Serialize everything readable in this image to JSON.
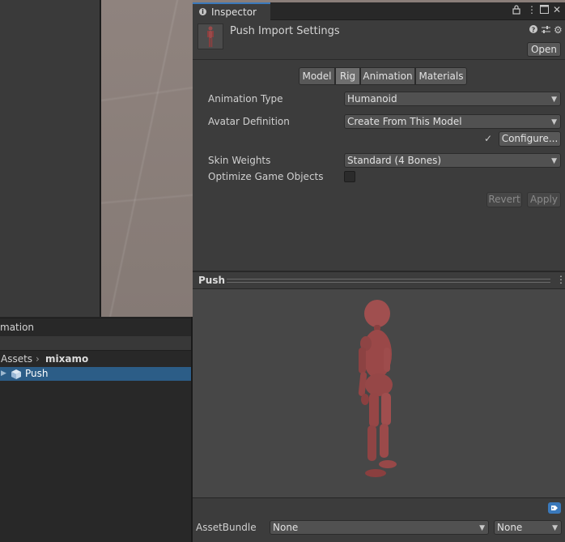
{
  "inspector": {
    "tab_label": "Inspector",
    "title": "Push Import Settings",
    "open_label": "Open",
    "header_icons": [
      "help-icon",
      "presets-icon",
      "settings-icon"
    ],
    "tab_icons": [
      "lock-icon",
      "more-icon",
      "maximize-icon",
      "close-icon"
    ],
    "tabs": [
      {
        "label": "Model",
        "active": false
      },
      {
        "label": "Rig",
        "active": true
      },
      {
        "label": "Animation",
        "active": false
      },
      {
        "label": "Materials",
        "active": false
      }
    ],
    "rig": {
      "animation_type_label": "Animation Type",
      "animation_type_value": "Humanoid",
      "avatar_definition_label": "Avatar Definition",
      "avatar_definition_value": "Create From This Model",
      "configure_label": "Configure...",
      "configure_check": "✓",
      "skin_weights_label": "Skin Weights",
      "skin_weights_value": "Standard (4 Bones)",
      "optimize_label": "Optimize Game Objects",
      "optimize_checked": false,
      "revert_label": "Revert",
      "apply_label": "Apply"
    }
  },
  "preview": {
    "title": "Push",
    "menu_icon": "more-vertical-icon"
  },
  "asset_bundle": {
    "label": "AssetBundle",
    "name_value": "None",
    "variant_value": "None"
  },
  "project": {
    "header_label": "mation",
    "breadcrumb": [
      "Assets",
      "mixamo"
    ],
    "breadcrumb_separator": "›",
    "items": [
      {
        "label": "Push",
        "icon": "model-prefab-icon",
        "selected": true
      }
    ]
  },
  "colors": {
    "accent": "#3a79bb",
    "selection": "#2c5d87",
    "figure": "#9a4a4a",
    "panel": "#3c3c3c",
    "background": "#282828"
  }
}
